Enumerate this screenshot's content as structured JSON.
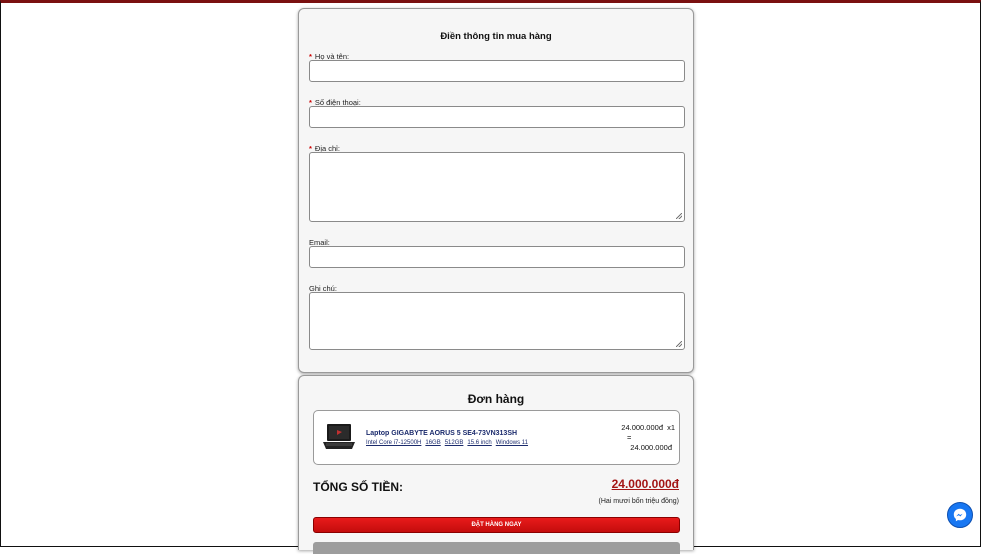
{
  "form": {
    "title": "Điền thông tin mua hàng",
    "required_mark": "*",
    "fullname_label": "Họ và tên:",
    "phone_label": "Số điện thoại:",
    "address_label": "Địa chỉ:",
    "email_label": "Email:",
    "note_label": "Ghi chú:"
  },
  "order": {
    "title": "Đơn hàng",
    "item": {
      "name": "Laptop GIGABYTE AORUS 5 SE4-73VN313SH",
      "specs": [
        "Intel Core i7-12500H",
        "16GB",
        "512GB",
        "15.6 inch",
        "Windows 11"
      ],
      "price": "24.000.000đ",
      "quantity": "x1",
      "equals": "=",
      "line_total": "24.000.000đ",
      "thumb_icon": "laptop-icon"
    },
    "total_label": "TỔNG SỐ TIỀN:",
    "total_value": "24.000.000đ",
    "total_in_words": "(Hai mươi bốn triệu đồng)",
    "order_button": "ĐẶT HÀNG NGAY"
  },
  "chat_icon": "messenger-icon",
  "colors": {
    "accent_red": "#d01212",
    "total_red": "#a31515",
    "link_blue": "#1a2a6c",
    "messenger_blue": "#1877f2"
  }
}
